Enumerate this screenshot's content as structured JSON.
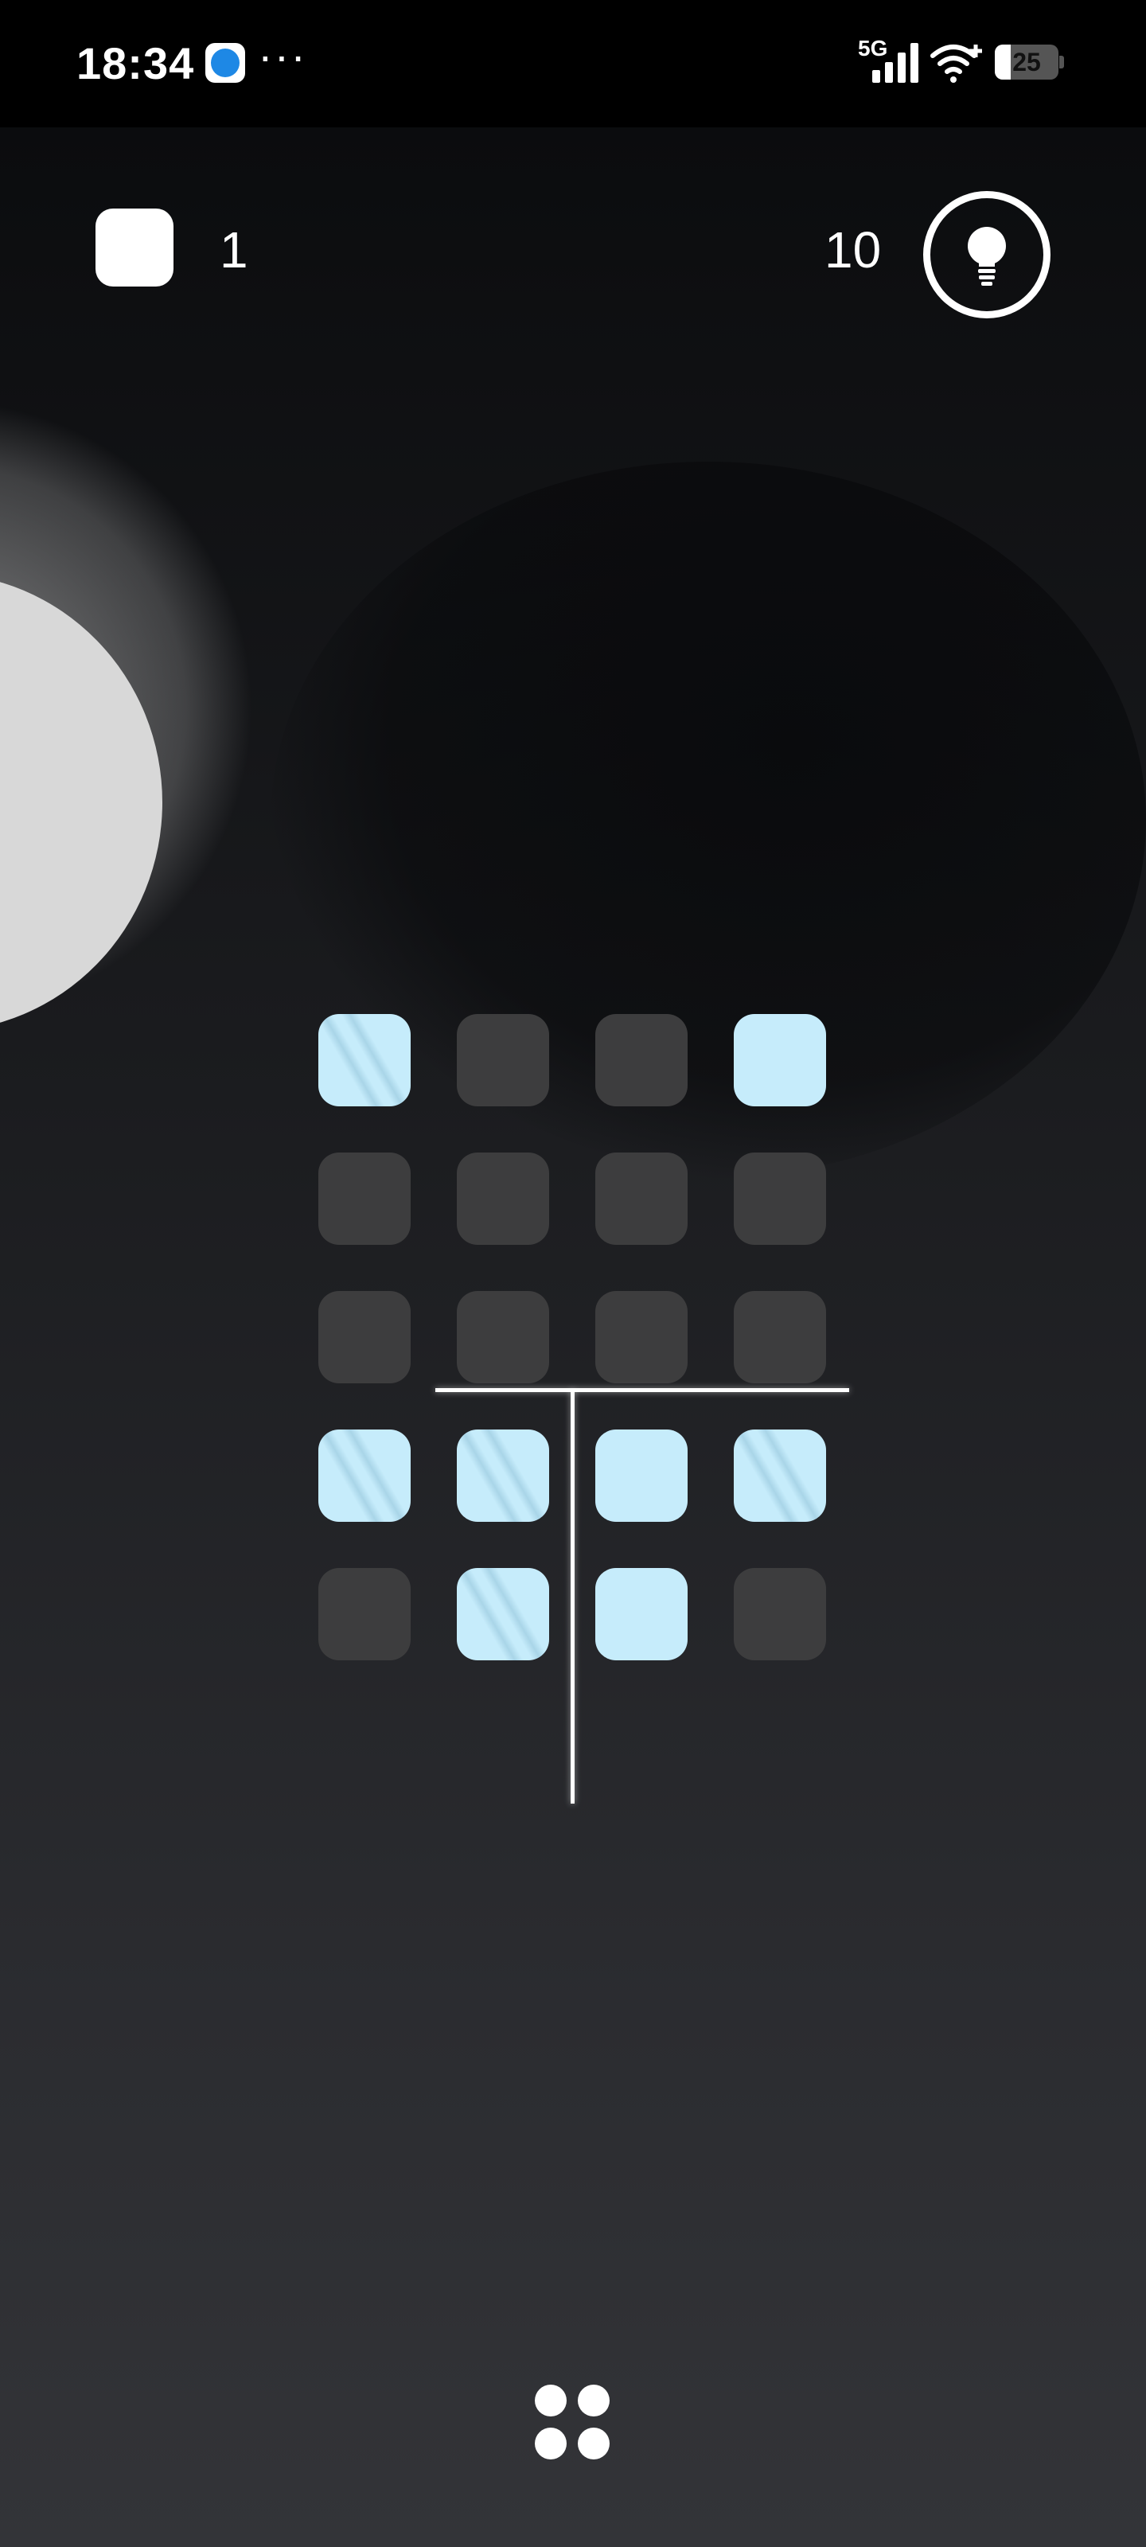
{
  "status_bar": {
    "time": "18:34",
    "more_indicator": "···",
    "network": "5G",
    "battery_level": "25",
    "icons": [
      "app-notification-icon",
      "signal-icon",
      "wifi-icon",
      "battery-icon"
    ]
  },
  "hud": {
    "moves_count": "1",
    "hints_count": "10",
    "hint_icon": "lightbulb-icon"
  },
  "board": {
    "rows": 5,
    "columns": 4,
    "legend": {
      "off": "dark tile",
      "lit": "solid light-blue tile",
      "glass": "striped light-blue tile"
    },
    "tiles": [
      [
        "glass",
        "off",
        "off",
        "lit"
      ],
      [
        "off",
        "off",
        "off",
        "off"
      ],
      [
        "off",
        "off",
        "off",
        "off"
      ],
      [
        "glass",
        "glass",
        "lit",
        "glass"
      ],
      [
        "off",
        "glass",
        "lit",
        "off"
      ]
    ],
    "walls": [
      {
        "orientation": "horizontal",
        "between_rows": [
          2,
          3
        ],
        "columns": [
          1,
          4
        ]
      },
      {
        "orientation": "vertical",
        "between_columns": [
          2,
          3
        ],
        "rows": [
          3,
          5
        ]
      }
    ]
  },
  "menu": {
    "icon": "menu-dots-icon"
  },
  "colors": {
    "tile_off": "#3d3d3e",
    "tile_lit": "#c6ecfb",
    "wall": "#ffffff",
    "background_top": "#0b0c0e",
    "background_bottom": "#333438",
    "moon": "#d8d8d8"
  }
}
